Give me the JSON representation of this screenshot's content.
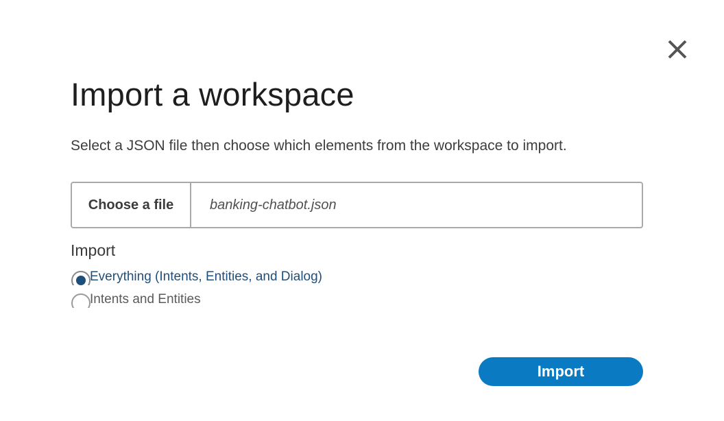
{
  "dialog": {
    "title": "Import a workspace",
    "description": "Select a JSON file then choose which elements from the workspace to import.",
    "close_icon": "close-icon"
  },
  "file_picker": {
    "button_label": "Choose a file",
    "file_name": "banking-chatbot.json"
  },
  "import_options": {
    "label": "Import",
    "options": [
      {
        "label": "Everything (Intents, Entities, and Dialog)",
        "selected": true
      },
      {
        "label": "Intents and Entities",
        "selected": false
      }
    ]
  },
  "actions": {
    "import_label": "Import"
  },
  "colors": {
    "primary": "#0a7bc2",
    "selected_text": "#1f4e7a",
    "border": "#a9a9a9"
  }
}
